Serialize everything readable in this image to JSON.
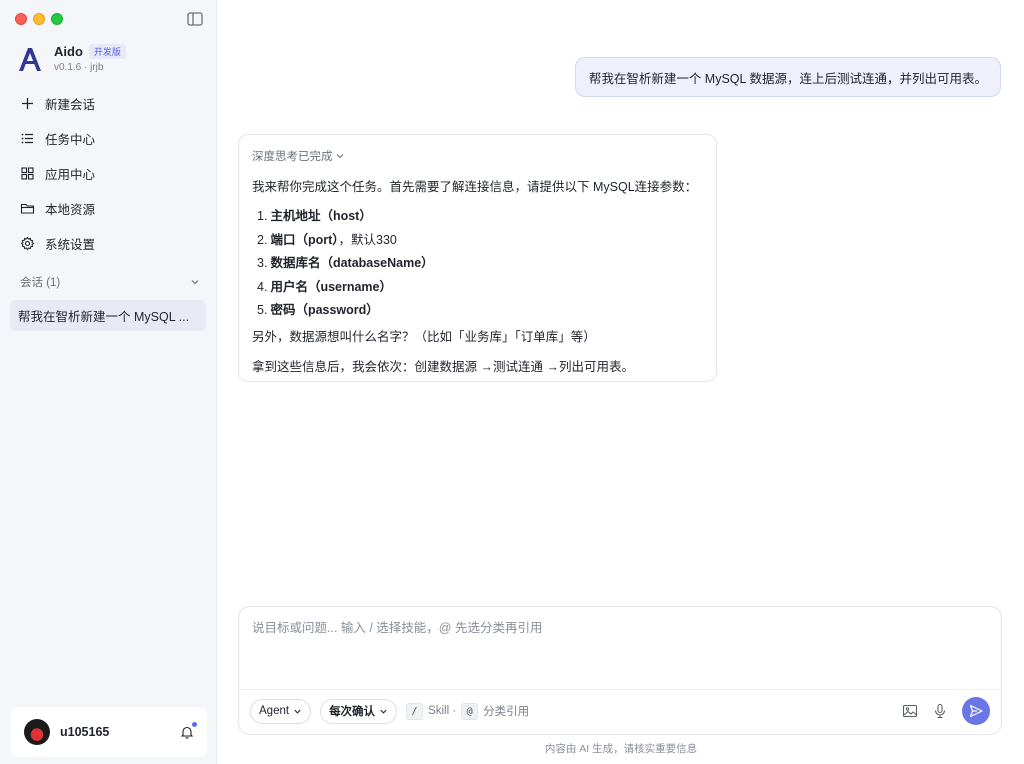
{
  "sidebar": {
    "brand": {
      "name": "Aido",
      "badge": "开发版",
      "version": "v0.1.6 · jrjb"
    },
    "nav": [
      {
        "label": "新建会话",
        "icon": "plus-icon"
      },
      {
        "label": "任务中心",
        "icon": "list-icon"
      },
      {
        "label": "应用中心",
        "icon": "grid-icon"
      },
      {
        "label": "本地资源",
        "icon": "folder-icon"
      },
      {
        "label": "系统设置",
        "icon": "gear-icon"
      }
    ],
    "conversations_header": "会话 (1)",
    "conversations": [
      {
        "title": "帮我在智析新建一个 MySQL ..."
      }
    ],
    "user": {
      "name": "u105165"
    }
  },
  "chat": {
    "user_message": "帮我在智析新建一个 MySQL 数据源，连上后测试连通，并列出可用表。",
    "assistant": {
      "thinking_label": "深度思考已完成",
      "intro": "我来帮你完成这个任务。首先需要了解连接信息，请提供以下 MySQL连接参数：",
      "items": [
        {
          "num": "1.",
          "label": "主机地址（host）",
          "note": ""
        },
        {
          "num": "2.",
          "label": "端口（port）",
          "note": "，默认330"
        },
        {
          "num": "3.",
          "label": "数据库名（databaseName）",
          "note": ""
        },
        {
          "num": "4.",
          "label": "用户名（username）",
          "note": ""
        },
        {
          "num": "5.",
          "label": "密码（password）",
          "note": ""
        }
      ],
      "extra": "另外，数据源想叫什么名字？（比如「业务库」「订单库」等）",
      "final": "拿到这些信息后，我会依次：创建数据源 →测试连通 →列出可用表。"
    }
  },
  "composer": {
    "placeholder": "说目标或问题... 输入 / 选择技能，@ 先选分类再引用",
    "mode_label": "Agent",
    "confirm_label": "每次确认",
    "slash_key": "/",
    "skill_label": "Skill ·",
    "at_key": "@",
    "ref_label": "分类引用"
  },
  "footer": {
    "disclaimer": "内容由 AI 生成，请核实重要信息"
  },
  "colors": {
    "accent": "#6a76e6",
    "sidebar_bg": "#f5f6fa",
    "user_bubble_bg": "#eef0fc"
  }
}
